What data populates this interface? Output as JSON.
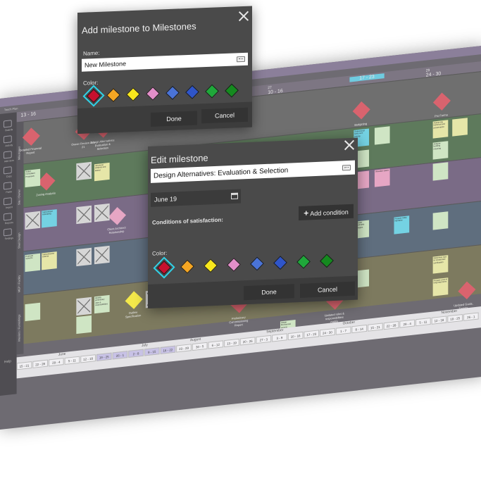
{
  "board": {
    "app_title": "Touch Plan",
    "weeks": [
      {
        "day": "27",
        "range": "10 - 16",
        "x": 0
      },
      {
        "day": "",
        "range": "17 - 23",
        "x": 1
      },
      {
        "day": "29",
        "range": "24 - 30",
        "x": 2
      }
    ],
    "small_range": "13 - 16",
    "nav": [
      "Boards",
      "Activity",
      "Add item",
      "Copy",
      "Paste",
      "Import",
      "Reports",
      "Settings"
    ],
    "lanes": [
      "Milestones",
      "Site / Owner",
      "Shell Design",
      "MEP / Facility",
      "Interiors / Furnishings"
    ],
    "milestone_labels": [
      "Detailed Financial Report",
      "Owner Review July 21",
      "Design Alternatives: Evaluation & Selection",
      "Zoning Analysis",
      "Client Architect Relationship",
      "Outline Specification",
      "Budgeting",
      "Pro Forma",
      "Preliminary Commissioning Report",
      "Updated roles & responsibilities matrix",
      "Updated Goals, Targets"
    ],
    "card_texts": [
      "Solicit Consultant Proposals",
      "Structural analysis and lateral",
      "Subcontract lump sum pricing",
      "Assess the historical and preservation",
      "Subcontract estimating",
      "Visualize space",
      "Analyze building massing",
      "Evaluate systems",
      "Subcontractor exterior",
      "Evaluate sustainable strategies",
      "Prepare Utility Narrative",
      "Identify preliminary roles & responsibilities",
      "Determine how to incorporate certification",
      "Prepare a list of long lead items",
      "Obtain Mechanical permits",
      "Develop the basic design"
    ],
    "months": [
      "June",
      "July",
      "August",
      "September",
      "October",
      "November"
    ],
    "bottom_ranges": [
      "15 - 21",
      "22 - 28",
      "29 - 4",
      "5 - 11",
      "12 - 18",
      "19 - 25",
      "26 - 1",
      "2 - 8",
      "9 - 15",
      "16 - 22",
      "23 - 29",
      "30 - 5",
      "6 - 12",
      "13 - 19",
      "20 - 26",
      "27 - 3",
      "3 - 9",
      "10 - 16",
      "17 - 23",
      "24 - 30",
      "1 - 7",
      "8 - 14",
      "15 - 21",
      "22 - 28",
      "29 - 4",
      "5 - 11",
      "12 - 18",
      "19 - 25",
      "26 - 1"
    ],
    "help": "Help"
  },
  "add_dialog": {
    "title": "Add milestone to  Milestones",
    "name_label": "Name:",
    "name_value": "New Milestone",
    "color_label": "Color:",
    "done_label": "Done",
    "cancel_label": "Cancel"
  },
  "edit_dialog": {
    "title": "Edit milestone",
    "name_value": "Design Alternatives: Evaluation & Selection",
    "date_value": "June 19",
    "conditions_label": "Conditions of satisfaction:",
    "add_condition_label": "Add condition",
    "color_label": "Color:",
    "done_label": "Done",
    "cancel_label": "Cancel"
  },
  "swatch_colors": [
    "#c8102e",
    "#f5a623",
    "#f8e71c",
    "#e38fc9",
    "#4a73d6",
    "#2f55c9",
    "#1fa83a",
    "#158a1f"
  ],
  "selected_swatch": 0,
  "lane_colors": [
    "#6f6f6f",
    "#5e7a5c",
    "#7a6b86",
    "#5f6e7e",
    "#7d7a5f"
  ],
  "milestone_color": "#dd5c6a",
  "accent_selection": "#2fd3e8"
}
